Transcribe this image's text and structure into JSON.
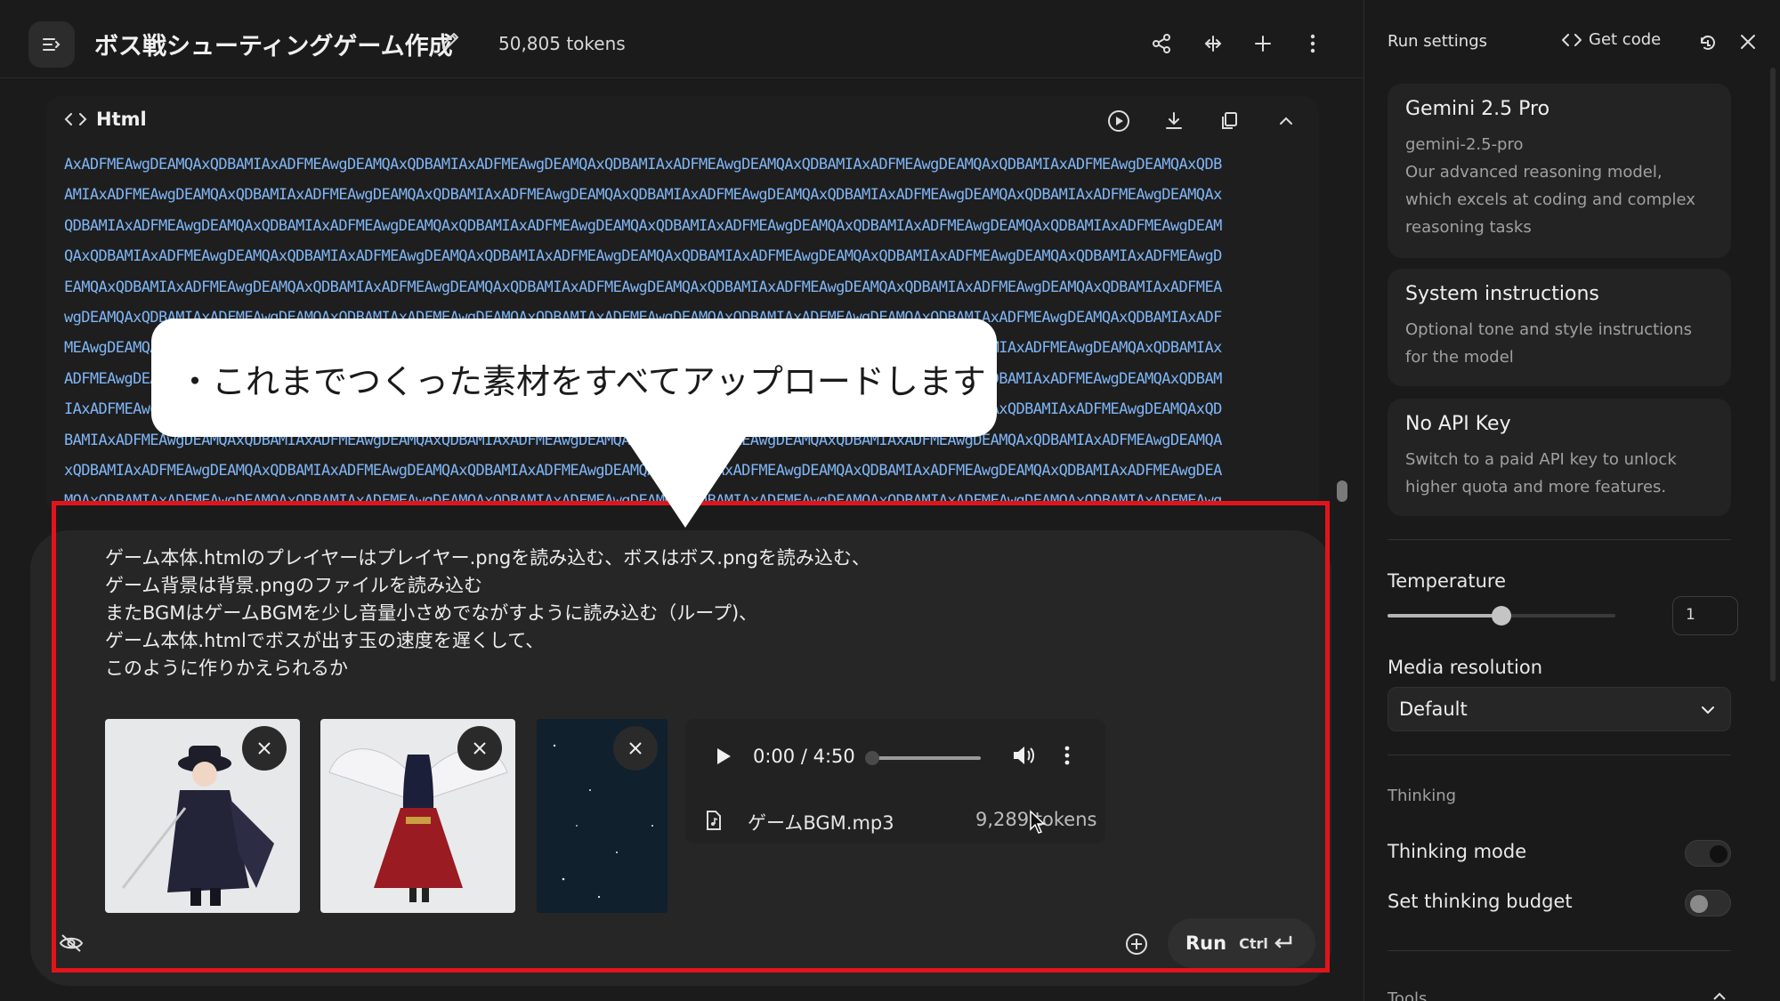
{
  "header": {
    "title": "ボス戦シューティングゲーム作成",
    "tokens": "50,805 tokens"
  },
  "code_block": {
    "language": "Html",
    "lines": [
      "AxADFMEAwgDEAMQAxQDBAMIAxADFMEAwgDEAMQAxQDBAMIAxADFMEAwgDEAMQAxQDBAMIAxADFMEAwgDEAMQAxQDBAMIAxADFMEAwgDEAMQAxQDBAMIAxADFMEAwgDEAMQAxQDB",
      "AMIAxADFMEAwgDEAMQAxQDBAMIAxADFMEAwgDEAMQAxQDBAMIAxADFMEAwgDEAMQAxQDBAMIAxADFMEAwgDEAMQAxQDBAMIAxADFMEAwgDEAMQAxQDBAMIAxADFMEAwgDEAMQAx",
      "QDBAMIAxADFMEAwgDEAMQAxQDBAMIAxADFMEAwgDEAMQAxQDBAMIAxADFMEAwgDEAMQAxQDBAMIAxADFMEAwgDEAMQAxQDBAMIAxADFMEAwgDEAMQAxQDBAMIAxADFMEAwgDEAM",
      "QAxQDBAMIAxADFMEAwgDEAMQAxQDBAMIAxADFMEAwgDEAMQAxQDBAMIAxADFMEAwgDEAMQAxQDBAMIAxADFMEAwgDEAMQAxQDBAMIAxADFMEAwgDEAMQAxQDBAMIAxADFMEAwgD",
      "EAMQAxQDBAMIAxADFMEAwgDEAMQAxQDBAMIAxADFMEAwgDEAMQAxQDBAMIAxADFMEAwgDEAMQAxQDBAMIAxADFMEAwgDEAMQAxQDBAMIAxADFMEAwgDEAMQAxQDBAMIAxADFMEA",
      "wgDEAMQAxQDBAMIAxADFMEAwgDEAMQAxQDBAMIAxADFMEAwgDEAMQAxQDBAMIAxADFMEAwgDEAMQAxQDBAMIAxADFMEAwgDEAMQAxQDBAMIAxADFMEAwgDEAMQAxQDBAMIAxADF",
      "MEAwgDEAMQAxQDBAMIAxADFMEAwgDEAMQAxQDBAMIAxADFMEAwgDEAMQAxQDBAMIAxADFMEAwgDEAMQAxQDBAMIAxADFMEAwgDEAMQAxQDBAMIAxADFMEAwgDEAMQAxQDBAMIAx",
      "ADFMEAwgDEAMQAxQDBAMIAxADFMEAwgDEAMQAxQDBAMIAxADFMEAwgDEAMQAxQDBAMIAxADFMEAwgDEAMQAxQDBAMIAxADFMEAwgDEAMQAxQDBAMIAxADFMEAwgDEAMQAxQDBAM",
      "IAxADFMEAwgDEAMQAxQDBAMIAxADFMEAwgDEAMQAxQDBAMIAxADFMEAwgDEAMQAxQDBAMIAxADFMEAwgDEAMQAxQDBAMIAxADFMEAwgDEAMQAxQDBAMIAxADFMEAwgDEAMQAxQD",
      "BAMIAxADFMEAwgDEAMQAxQDBAMIAxADFMEAwgDEAMQAxQDBAMIAxADFMEAwgDEAMQAxQDBAMIAxADFMEAwgDEAMQAxQDBAMIAxADFMEAwgDEAMQAxQDBAMIAxADFMEAwgDEAMQA",
      "xQDBAMIAxADFMEAwgDEAMQAxQDBAMIAxADFMEAwgDEAMQAxQDBAMIAxADFMEAwgDEAMQAxQDBAMIAxADFMEAwgDEAMQAxQDBAMIAxADFMEAwgDEAMQAxQDBAMIAxADFMEAwgDEA",
      "MQAxQDBAMIAxADFMEAwgDEAMQAxQDBAMIAxADFMEAwgDEAMQAxQDBAMIAxADFMEAwgDEAMQAxQDBAMIAxADFMEAwgDEAMQAxQDBAMIAxADFMEAwgDEAMQAxQDBAMIAxADFMEAwg"
    ]
  },
  "callout": {
    "text": "・これまでつくった素材をすべてアップロードします"
  },
  "prompt": {
    "lines": [
      "ゲーム本体.htmlのプレイヤーはプレイヤー.pngを読み込む、ボスはボス.pngを読み込む、",
      "ゲーム背景は背景.pngのファイルを読み込む",
      "またBGMはゲームBGMを少し音量小さめでながすように読み込む（ループ)、",
      "ゲーム本体.htmlでボスが出す玉の速度を遅くして、",
      "このように作りかえられるか"
    ]
  },
  "attachments": {
    "audio": {
      "time": "0:00 / 4:50",
      "progress": 0,
      "file_name": "ゲームBGM.mp3",
      "tokens": "9,289 tokens"
    }
  },
  "run": {
    "label": "Run",
    "shortcut": "Ctrl"
  },
  "settings": {
    "title": "Run settings",
    "get_code": "Get code",
    "model": {
      "name": "Gemini 2.5 Pro",
      "id": "gemini-2.5-pro",
      "description": "Our advanced reasoning model, which excels at coding and complex reasoning tasks"
    },
    "system": {
      "title": "System instructions",
      "description": "Optional tone and style instructions for the model"
    },
    "api": {
      "title": "No API Key",
      "description": "Switch to a paid API key to unlock higher quota and more features."
    },
    "temperature": {
      "label": "Temperature",
      "value": "1",
      "slider_fraction": 0.5
    },
    "media_resolution": {
      "label": "Media resolution",
      "value": "Default"
    },
    "thinking": {
      "section": "Thinking",
      "mode_label": "Thinking mode",
      "mode_on": true,
      "budget_label": "Set thinking budget",
      "budget_on": false
    },
    "tools_label": "Tools"
  },
  "colors": {
    "highlight": "#e1141c",
    "code_text": "#7fb5f5",
    "background": "#1b1b1b"
  }
}
